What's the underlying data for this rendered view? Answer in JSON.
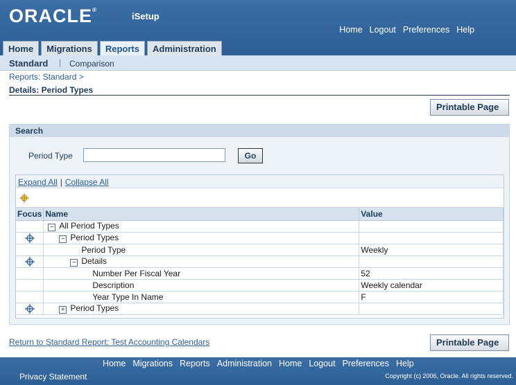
{
  "header": {
    "logo_text": "ORACLE",
    "logo_mark": "®",
    "app_name": "iSetup",
    "global_links": [
      "Home",
      "Logout",
      "Preferences",
      "Help"
    ]
  },
  "tabs": [
    {
      "label": "Home",
      "active": false
    },
    {
      "label": "Migrations",
      "active": false
    },
    {
      "label": "Reports",
      "active": true
    },
    {
      "label": "Administration",
      "active": false
    }
  ],
  "subtabs": {
    "standard": "Standard",
    "separator": "|",
    "comparison": "Comparison"
  },
  "breadcrumb": "Reports: Standard  >",
  "page_title": "Details: Period Types",
  "buttons": {
    "printable_page": "Printable Page",
    "go": "Go"
  },
  "search": {
    "header": "Search",
    "field_label": "Period Type",
    "field_value": ""
  },
  "tree": {
    "expand_all": "Expand All",
    "collapse_all": "Collapse All",
    "separator": "|",
    "columns": {
      "focus": "Focus",
      "name": "Name",
      "value": "Value"
    },
    "rows": [
      {
        "focus": false,
        "toggle": "−",
        "name": "All Period Types",
        "value": "",
        "indent": 0
      },
      {
        "focus": true,
        "toggle": "−",
        "name": "Period Types",
        "value": "",
        "indent": 1
      },
      {
        "focus": false,
        "toggle": "",
        "name": "Period Type",
        "value": "Weekly",
        "indent": 2
      },
      {
        "focus": true,
        "toggle": "−",
        "name": "Details",
        "value": "",
        "indent": 2
      },
      {
        "focus": false,
        "toggle": "",
        "name": "Number Per Fiscal Year",
        "value": "52",
        "indent": 3
      },
      {
        "focus": false,
        "toggle": "",
        "name": "Description",
        "value": "Weekly calendar",
        "indent": 3
      },
      {
        "focus": false,
        "toggle": "",
        "name": "Year Type In Name",
        "value": "F",
        "indent": 3
      },
      {
        "focus": true,
        "toggle": "+",
        "name": "Period Types",
        "value": "",
        "indent": 1
      }
    ]
  },
  "return_link": "Return to Standard Report: Test Accounting Calendars",
  "footer": {
    "links": [
      "Home",
      "Migrations",
      "Reports",
      "Administration",
      "Home",
      "Logout",
      "Preferences",
      "Help"
    ],
    "privacy": "Privacy Statement",
    "copyright": "Copyright (c) 2006, Oracle. All rights reserved."
  },
  "icons": {
    "focus": "focus-crosshair-icon",
    "root_focus": "focus-root-icon"
  },
  "colors": {
    "brand_blue": "#2d5f95",
    "navy_text": "#1f3b57",
    "subtab_bg": "#d6e4f2"
  }
}
